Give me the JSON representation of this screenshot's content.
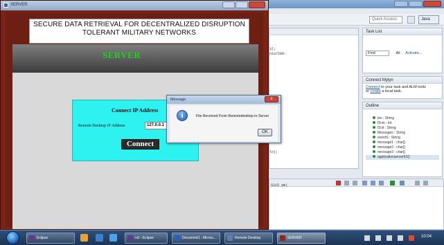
{
  "server_window": {
    "title": "SERVER",
    "heading_line1": "SECURE DATA RETRIEVAL FOR DECENTRALIZED DISRUPTION",
    "heading_line2": "TOLERANT MILITARY NETWORKS",
    "server_label": "SERVER",
    "connect_title": "Connect IP Address",
    "ip_label": "Remote Desktop IP Address",
    "ip_value": "127.0.0.1",
    "connect_button": "Connect"
  },
  "message_dialog": {
    "title": "Message",
    "close_label": "x",
    "text": "File Received From Remotedesktop to Server",
    "ok_button": "OK",
    "icon": "info-icon"
  },
  "eclipse": {
    "quick_access": "Quick Access",
    "java_perspective": "Java",
    "task_list_title": "Task List",
    "find_label": "Find",
    "all_label": "All",
    "activate_label": "Activate...",
    "mylyn_title": "Connect Mylyn",
    "mylyn_link1": "Connect",
    "mylyn_text1": "to your task and ALM tools",
    "mylyn_text2": "or",
    "mylyn_link2": "create",
    "mylyn_text3": "a local task.",
    "outline_title": "Outline",
    "outline_items": [
      "len : String",
      "f2ctn : int",
      "f2ctt : String",
      "Messages : String",
      "eventS : String",
      "message1 : char[]",
      "message2 : char[]",
      "message3 : char[]",
      "applicationserver62()"
    ],
    "editor_fragments": [
      "3);",
      "nia7280-",
      "lo);"
    ],
    "console_text": "5215 am)"
  },
  "taskbar": {
    "items": [
      "Eclipse",
      "",
      "",
      "ncl - Eclipse",
      "Document1 - Micros...",
      "Remote Desktop",
      "SERVER"
    ],
    "clock": "10:04"
  }
}
